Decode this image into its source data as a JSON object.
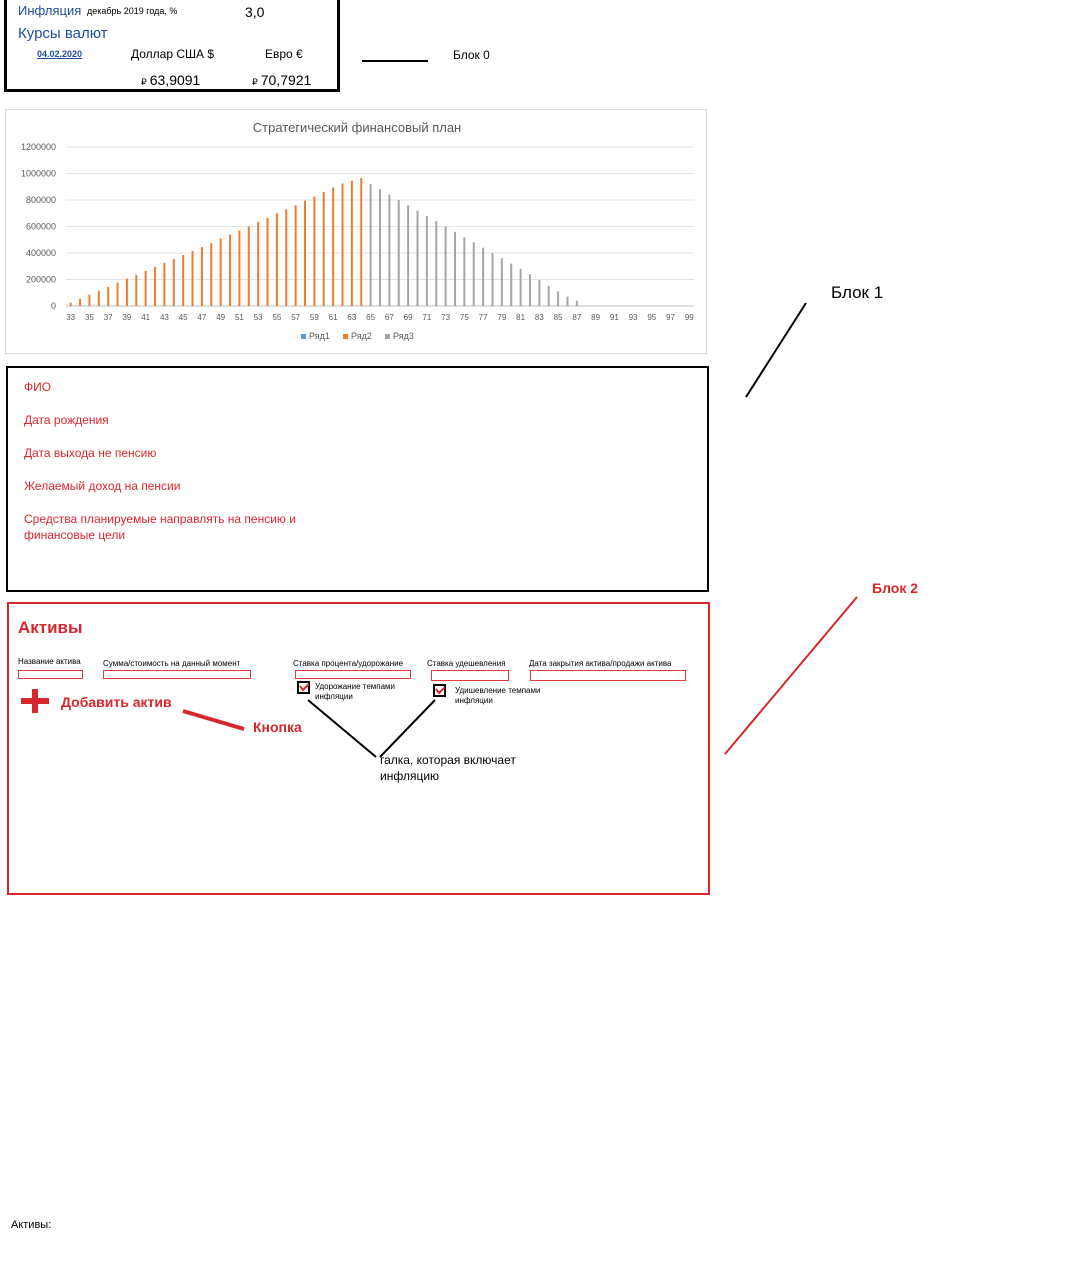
{
  "block0": {
    "inflation_link": "Инфляция",
    "inflation_period": "декабрь 2019 года, %",
    "inflation_value": "3,0",
    "fx_title": "Курсы валют",
    "fx_date": "04.02.2020",
    "usd_header": "Доллар США $",
    "eur_header": "Евро €",
    "rub_sign": "₽",
    "usd_value": "63,9091",
    "eur_value": "70,7921"
  },
  "annotations": {
    "block0": "Блок 0",
    "block1": "Блок 1",
    "block2": "Блок 2",
    "button": "Кнопка",
    "checkbox_note": "галка, которая включает инфляцию"
  },
  "form": {
    "fio": "ФИО",
    "birth_date": "Дата рождения",
    "retire_date": "Дата выхода не пенсию",
    "desired_income": "Желаемый доход на пенсии",
    "funds": "Средства планируемые направлять на пенсию и финансовые цели"
  },
  "assets": {
    "title": "Активы",
    "col_name": "Название актива",
    "col_amount": "Сумма/стоимость на данный момент",
    "col_rate": "Ставка процента/удорожание",
    "col_cheap": "Ставка удешевления",
    "col_close": "Дата закрытия актива/продажи  актива",
    "cb_inflation_up": "Удорожание темпами инфляции",
    "cb_inflation_down": "Удишевление темпами инфляции",
    "add_button": "Добавить актив"
  },
  "footer_text": "Активы:",
  "colors": {
    "series1": "#5b9bd5",
    "series2": "#ed7d31",
    "series3": "#a5a5a5",
    "accent_red": "#d7262c"
  },
  "chart_data": {
    "type": "bar",
    "title": "Стратегический финансовый план",
    "ylim": [
      0,
      1200000
    ],
    "yticks": [
      0,
      200000,
      400000,
      600000,
      800000,
      1000000,
      1200000
    ],
    "xtick_labels": [
      "33",
      "35",
      "37",
      "39",
      "41",
      "43",
      "45",
      "47",
      "49",
      "51",
      "53",
      "55",
      "57",
      "59",
      "61",
      "63",
      "65",
      "67",
      "69",
      "71",
      "73",
      "75",
      "77",
      "79",
      "81",
      "83",
      "85",
      "87",
      "89",
      "91",
      "93",
      "95",
      "97",
      "99"
    ],
    "x_start": 33,
    "legend": [
      "Ряд1",
      "Ряд2",
      "Ряд3"
    ],
    "legend_position": "bottom",
    "grid": true,
    "series": [
      {
        "name": "Ряд1",
        "values": []
      },
      {
        "name": "Ряд2",
        "x": [
          33,
          34,
          35,
          36,
          37,
          38,
          39,
          40,
          41,
          42,
          43,
          44,
          45,
          46,
          47,
          48,
          49,
          50,
          51,
          52,
          53,
          54,
          55,
          56,
          57,
          58,
          59,
          60,
          61,
          62,
          63,
          64
        ],
        "values": [
          25000,
          55000,
          85000,
          115000,
          145000,
          175000,
          205000,
          235000,
          265000,
          295000,
          325000,
          355000,
          385000,
          415000,
          445000,
          475000,
          510000,
          540000,
          570000,
          600000,
          635000,
          665000,
          700000,
          730000,
          760000,
          795000,
          825000,
          860000,
          895000,
          925000,
          945000,
          965000
        ]
      },
      {
        "name": "Ряд3",
        "x": [
          65,
          66,
          67,
          68,
          69,
          70,
          71,
          72,
          73,
          74,
          75,
          76,
          77,
          78,
          79,
          80,
          81,
          82,
          83,
          84,
          85,
          86,
          87
        ],
        "values": [
          920000,
          880000,
          840000,
          800000,
          760000,
          720000,
          680000,
          640000,
          600000,
          560000,
          520000,
          480000,
          440000,
          400000,
          360000,
          320000,
          280000,
          240000,
          195000,
          150000,
          110000,
          70000,
          40000
        ]
      }
    ]
  }
}
